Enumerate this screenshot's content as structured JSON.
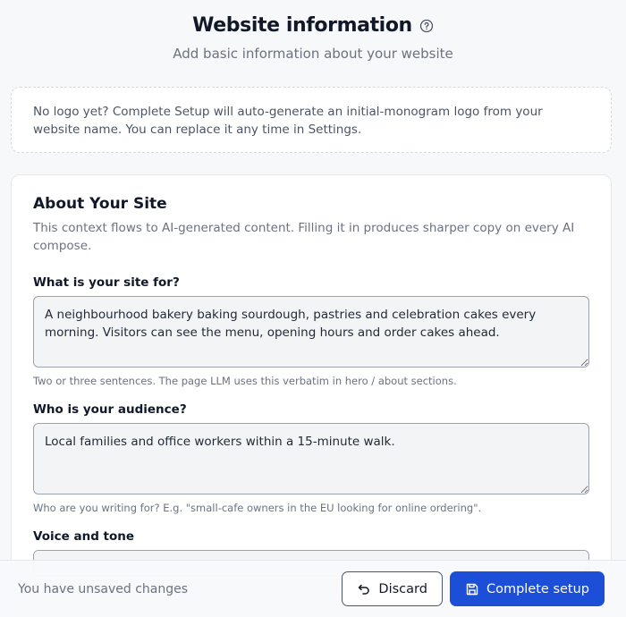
{
  "header": {
    "title": "Website information",
    "subtitle": "Add basic information about your website",
    "help_icon": "question-circle-icon"
  },
  "notice": {
    "text": "No logo yet? Complete Setup will auto-generate an initial-monogram logo from your website name. You can replace it any time in Settings."
  },
  "about": {
    "title": "About Your Site",
    "description": "This context flows to AI-generated content. Filling it in produces sharper copy on every AI compose.",
    "fields": [
      {
        "label": "What is your site for?",
        "value": "A neighbourhood bakery baking sourdough, pastries and celebration cakes every morning. Visitors can see the menu, opening hours and order cakes ahead.",
        "hint": "Two or three sentences. The page LLM uses this verbatim in hero / about sections."
      },
      {
        "label": "Who is your audience?",
        "value": "Local families and office workers within a 15-minute walk.",
        "hint": "Who are you writing for? E.g. \"small-cafe owners in the EU looking for online ordering\"."
      },
      {
        "label": "Voice and tone",
        "value": ""
      }
    ]
  },
  "footer": {
    "status": "You have unsaved changes",
    "discard_label": "Discard",
    "complete_label": "Complete setup",
    "discard_icon": "undo-icon",
    "complete_icon": "save-icon",
    "primary_color": "#1d4ed8"
  }
}
